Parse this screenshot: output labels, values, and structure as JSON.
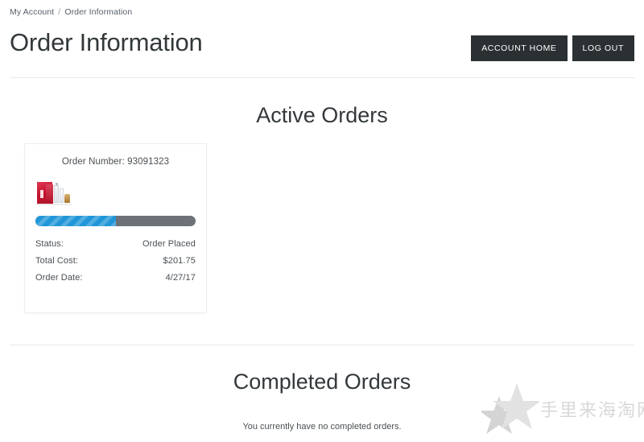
{
  "breadcrumb": {
    "items": [
      {
        "label": "My Account"
      },
      {
        "label": "Order Information"
      }
    ],
    "separator": "/"
  },
  "header": {
    "title": "Order Information",
    "buttons": [
      {
        "label": "ACCOUNT HOME",
        "name": "account-home-button"
      },
      {
        "label": "LOG OUT",
        "name": "log-out-button"
      }
    ]
  },
  "active_orders": {
    "heading": "Active Orders",
    "orders": [
      {
        "order_number_text": "Order Number: 93091323",
        "order_number": "93091323",
        "thumbnail_alt": "product-thumbnail",
        "progress_percent": 50,
        "progress_color": "#2196d8",
        "progress_track_color": "#6d7278",
        "details": [
          {
            "label": "Status:",
            "value": "Order Placed"
          },
          {
            "label": "Total Cost:",
            "value": "$201.75"
          },
          {
            "label": "Order Date:",
            "value": "4/27/17"
          }
        ]
      }
    ]
  },
  "completed_orders": {
    "heading": "Completed Orders",
    "empty_message": "You currently have no completed orders."
  },
  "watermark": {
    "text": "手里来海淘网",
    "color": "#d8d8d8"
  },
  "theme": {
    "button_bg": "#2b3033",
    "button_text": "#ffffff",
    "divider": "#ebe9e7",
    "text": "#33383b"
  }
}
